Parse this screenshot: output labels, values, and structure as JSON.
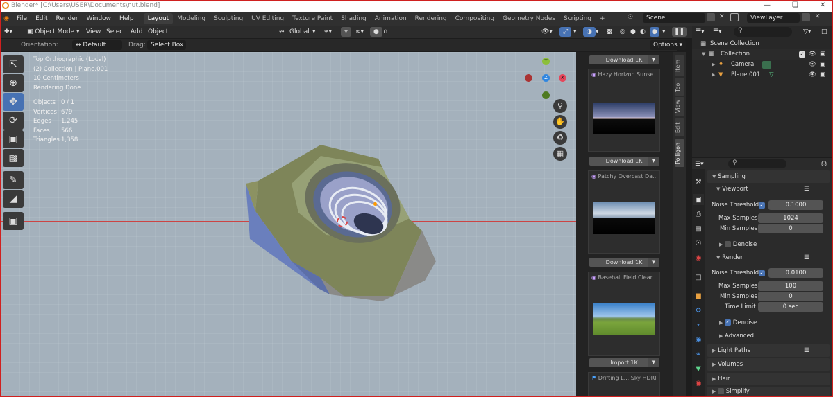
{
  "app": {
    "title": "Blender* [C:\\Users\\USER\\Documents\\nut.blend]"
  },
  "menu": [
    "File",
    "Edit",
    "Render",
    "Window",
    "Help"
  ],
  "workspaces": [
    "Layout",
    "Modeling",
    "Sculpting",
    "UV Editing",
    "Texture Paint",
    "Shading",
    "Animation",
    "Rendering",
    "Compositing",
    "Geometry Nodes",
    "Scripting"
  ],
  "workspace_add": "+",
  "scene": {
    "label": "Scene",
    "view_layer": "ViewLayer"
  },
  "viewport_header": {
    "mode": "Object Mode",
    "view": "View",
    "select": "Select",
    "add": "Add",
    "object": "Object",
    "transform": "Global"
  },
  "tool_header": {
    "orientation_label": "Orientation:",
    "orientation_value": "Default",
    "drag_label": "Drag:",
    "drag_value": "Select Box",
    "options": "Options"
  },
  "overlay": {
    "line1": "Top Orthographic (Local)",
    "line2": "(2) Collection | Plane.001",
    "line3": "10 Centimeters",
    "line4": "Rendering Done",
    "stats": [
      {
        "k": "Objects",
        "v": "0 / 1"
      },
      {
        "k": "Vertices",
        "v": "679"
      },
      {
        "k": "Edges",
        "v": "1,245"
      },
      {
        "k": "Faces",
        "v": "566"
      },
      {
        "k": "Triangles",
        "v": "1,358"
      }
    ]
  },
  "gizmo": {
    "y": "Y",
    "x": "X",
    "z": "Z"
  },
  "assets": [
    {
      "name": "Hazy Horizon Sunse...",
      "button": "Download 1K"
    },
    {
      "name": "Patchy Overcast Da...",
      "button": "Download 1K"
    },
    {
      "name": "Baseball Field Clear...",
      "button": "Download 1K"
    },
    {
      "name": "Drifting L... Sky HDRI",
      "button": "Import 1K"
    }
  ],
  "asset_top_button": "Download 1K",
  "side_tabs": [
    "Item",
    "Tool",
    "View",
    "Edit",
    "Polligon"
  ],
  "outliner": {
    "root": "Scene Collection",
    "collection": "Collection",
    "items": [
      "Camera",
      "Plane.001"
    ]
  },
  "properties": {
    "sampling": "Sampling",
    "viewport": "Viewport",
    "render": "Render",
    "noise_threshold_label": "Noise Threshold",
    "viewport_noise": "0.1000",
    "render_noise": "0.0100",
    "max_samples_label": "Max Samples",
    "min_samples_label": "Min Samples",
    "viewport_max": "1024",
    "viewport_min": "0",
    "render_max": "100",
    "render_min": "0",
    "time_limit_label": "Time Limit",
    "time_limit": "0 sec",
    "denoise": "Denoise",
    "advanced": "Advanced",
    "light_paths": "Light Paths",
    "volumes": "Volumes",
    "hair": "Hair",
    "simplify": "Simplify"
  },
  "colors": {
    "accent": "#4772b3",
    "frame": "#d0201f"
  }
}
